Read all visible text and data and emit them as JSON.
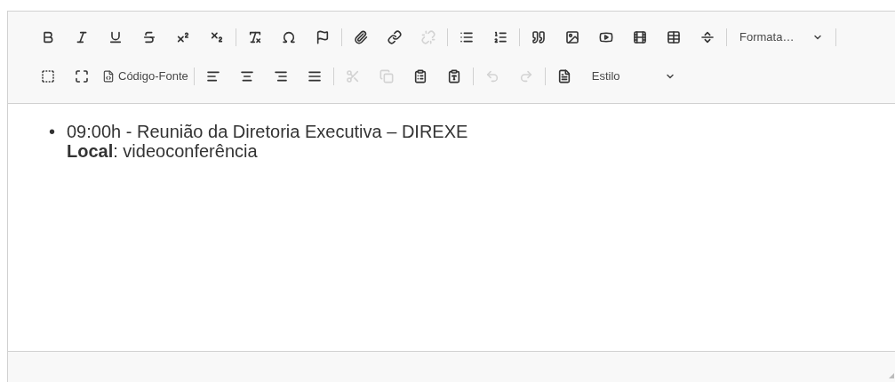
{
  "toolbar": {
    "rows": [
      [
        {
          "kind": "button",
          "disabled": false
        },
        {
          "kind": "button",
          "disabled": false
        },
        {
          "kind": "button",
          "disabled": false
        },
        {
          "kind": "button",
          "disabled": false
        },
        {
          "kind": "button",
          "disabled": false
        },
        {
          "kind": "button",
          "disabled": false
        },
        {
          "kind": "separator"
        },
        {
          "kind": "button",
          "disabled": false
        },
        {
          "kind": "button",
          "disabled": false
        },
        {
          "kind": "button",
          "disabled": false
        },
        {
          "kind": "separator"
        },
        {
          "kind": "button",
          "disabled": false
        },
        {
          "kind": "button",
          "disabled": false
        },
        {
          "kind": "button",
          "disabled": true
        },
        {
          "kind": "separator"
        },
        {
          "kind": "button",
          "disabled": false
        },
        {
          "kind": "button",
          "disabled": false
        },
        {
          "kind": "separator"
        },
        {
          "kind": "button",
          "disabled": false
        },
        {
          "kind": "button",
          "disabled": false
        },
        {
          "kind": "button",
          "disabled": false
        },
        {
          "kind": "button",
          "disabled": false
        },
        {
          "kind": "button",
          "disabled": false
        },
        {
          "kind": "button",
          "disabled": false
        },
        {
          "kind": "separator"
        },
        {
          "kind": "dropdown",
          "label": "Formata…"
        },
        {
          "kind": "separator"
        }
      ],
      [
        {
          "kind": "button",
          "disabled": false
        },
        {
          "kind": "button",
          "disabled": false
        },
        {
          "kind": "text_button",
          "label": "Código-Fonte",
          "disabled": false
        },
        {
          "kind": "separator"
        },
        {
          "kind": "button",
          "disabled": false
        },
        {
          "kind": "button",
          "disabled": false
        },
        {
          "kind": "button",
          "disabled": false
        },
        {
          "kind": "button",
          "disabled": false
        },
        {
          "kind": "separator"
        },
        {
          "kind": "button",
          "disabled": true
        },
        {
          "kind": "button",
          "disabled": true
        },
        {
          "kind": "button",
          "disabled": false
        },
        {
          "kind": "button",
          "disabled": false
        },
        {
          "kind": "separator"
        },
        {
          "kind": "button",
          "disabled": true
        },
        {
          "kind": "button",
          "disabled": true
        },
        {
          "kind": "separator"
        },
        {
          "kind": "button",
          "disabled": false
        },
        {
          "kind": "dropdown",
          "label": "Estilo"
        }
      ]
    ]
  },
  "content": {
    "list": [
      {
        "marker": "•",
        "lines": [
          "09:00h - Reunião da Diretoria Executiva – DIREXE",
          "**Local**: videoconferência"
        ]
      }
    ]
  }
}
